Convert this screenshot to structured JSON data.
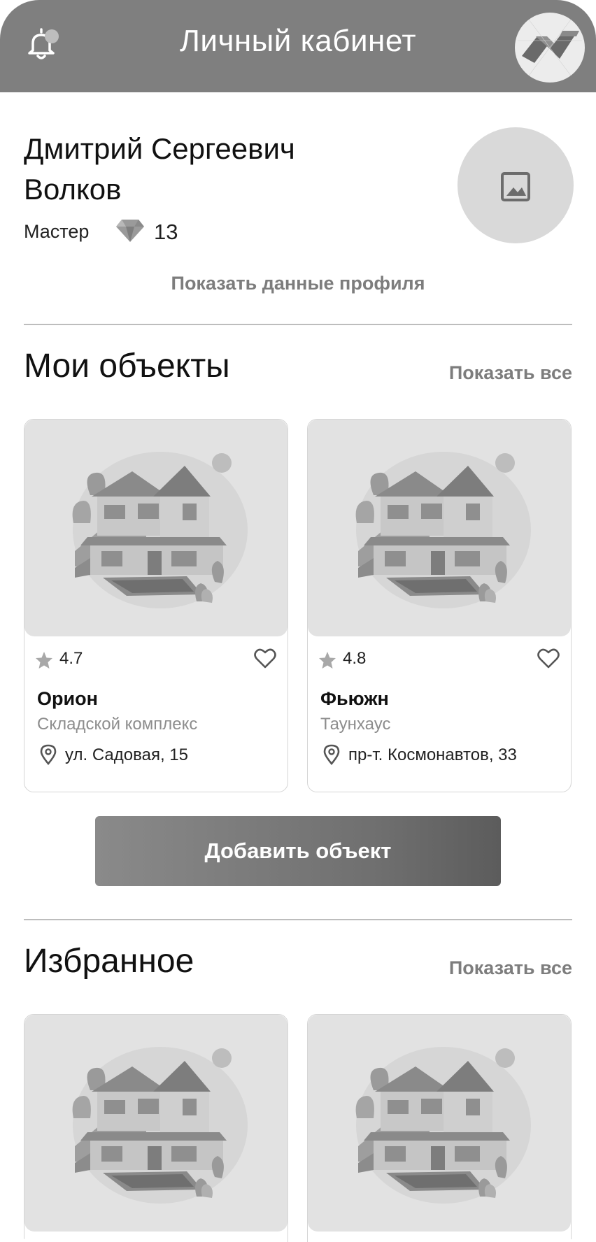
{
  "header": {
    "title": "Личный кабинет"
  },
  "profile": {
    "name": "Дмитрий Сергеевич Волков",
    "role": "Мастер",
    "points": "13",
    "show_profile_label": "Показать данные профиля"
  },
  "my_objects": {
    "title": "Мои объекты",
    "show_all_label": "Показать все",
    "items": [
      {
        "rating": "4.7",
        "name": "Орион",
        "type": "Складской комплекс",
        "address": "ул. Садовая, 15"
      },
      {
        "rating": "4.8",
        "name": "Фьюжн",
        "type": "Таунхаус",
        "address": "пр-т. Космонавтов, 33"
      }
    ],
    "add_button_label": "Добавить объект"
  },
  "favorites": {
    "title": "Избранное",
    "show_all_label": "Показать все"
  },
  "icons": {
    "notifications": "bell-icon",
    "logo": "logo-icon",
    "avatar_placeholder": "image-icon",
    "points": "gem-icon",
    "rating": "star-icon",
    "favorite": "heart-icon",
    "address": "location-pin-icon"
  },
  "colors": {
    "header_bg": "#7f7f7f",
    "muted_text": "#7d7d7d",
    "button_gradient_start": "#8a8a8a",
    "button_gradient_end": "#5c5c5c"
  }
}
